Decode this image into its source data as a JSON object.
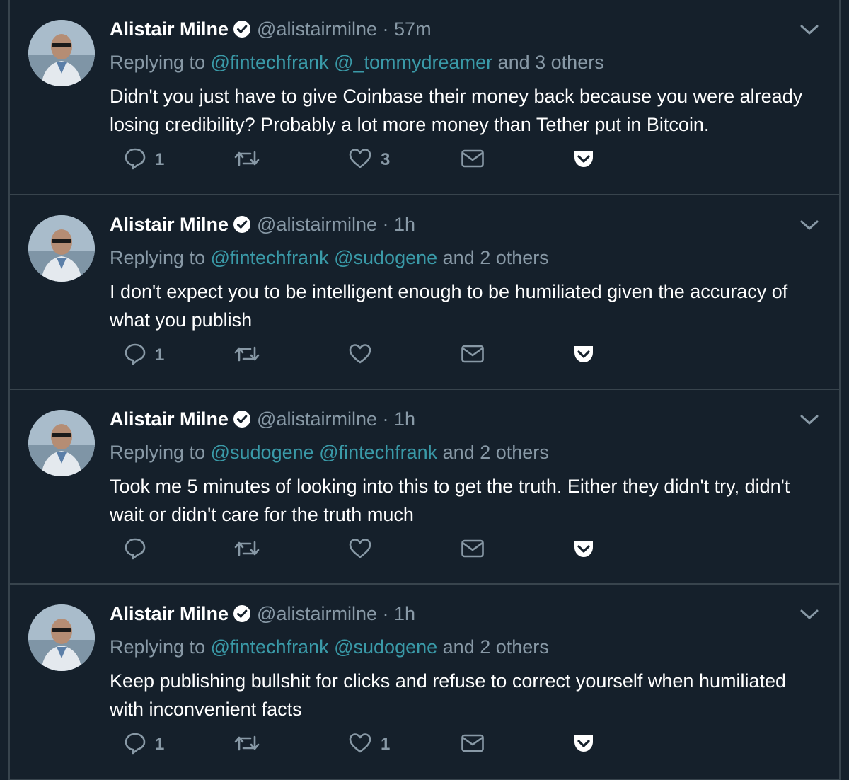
{
  "tweets": [
    {
      "name": "Alistair Milne",
      "handle": "@alistairmilne",
      "separator": "·",
      "time": "57m",
      "replying_prefix": "Replying to",
      "mentions": [
        "@fintechfrank",
        "@_tommydreamer"
      ],
      "others": "and 3 others",
      "text": "Didn't you just have to give Coinbase their money back because you were already losing credibility? Probably a lot more money than Tether put in Bitcoin.",
      "reply_count": "1",
      "retweet_count": "",
      "like_count": "3"
    },
    {
      "name": "Alistair Milne",
      "handle": "@alistairmilne",
      "separator": "·",
      "time": "1h",
      "replying_prefix": "Replying to",
      "mentions": [
        "@fintechfrank",
        "@sudogene"
      ],
      "others": "and 2 others",
      "text": "I don't expect you to be intelligent enough to be humiliated given the accuracy of what you publish",
      "reply_count": "1",
      "retweet_count": "",
      "like_count": ""
    },
    {
      "name": "Alistair Milne",
      "handle": "@alistairmilne",
      "separator": "·",
      "time": "1h",
      "replying_prefix": "Replying to",
      "mentions": [
        "@sudogene",
        "@fintechfrank"
      ],
      "others": "and 2 others",
      "text": "Took me 5 minutes of looking into this to get the truth. Either they didn't try, didn't wait or didn't care for the truth much",
      "reply_count": "",
      "retweet_count": "",
      "like_count": ""
    },
    {
      "name": "Alistair Milne",
      "handle": "@alistairmilne",
      "separator": "·",
      "time": "1h",
      "replying_prefix": "Replying to",
      "mentions": [
        "@fintechfrank",
        "@sudogene"
      ],
      "others": "and 2 others",
      "text": "Keep publishing bullshit for clicks and refuse to correct yourself when humiliated with inconvenient facts",
      "reply_count": "1",
      "retweet_count": "",
      "like_count": "1"
    }
  ],
  "icons": {
    "reply": "reply-icon",
    "retweet": "retweet-icon",
    "like": "heart-icon",
    "dm": "envelope-icon",
    "pocket": "pocket-icon",
    "verified": "verified-badge-icon",
    "caret": "chevron-down-icon"
  },
  "colors": {
    "background": "#15202b",
    "divider": "#38444d",
    "secondary_text": "#8899a6",
    "mention": "#3a9aa8",
    "primary_text": "#ffffff"
  }
}
